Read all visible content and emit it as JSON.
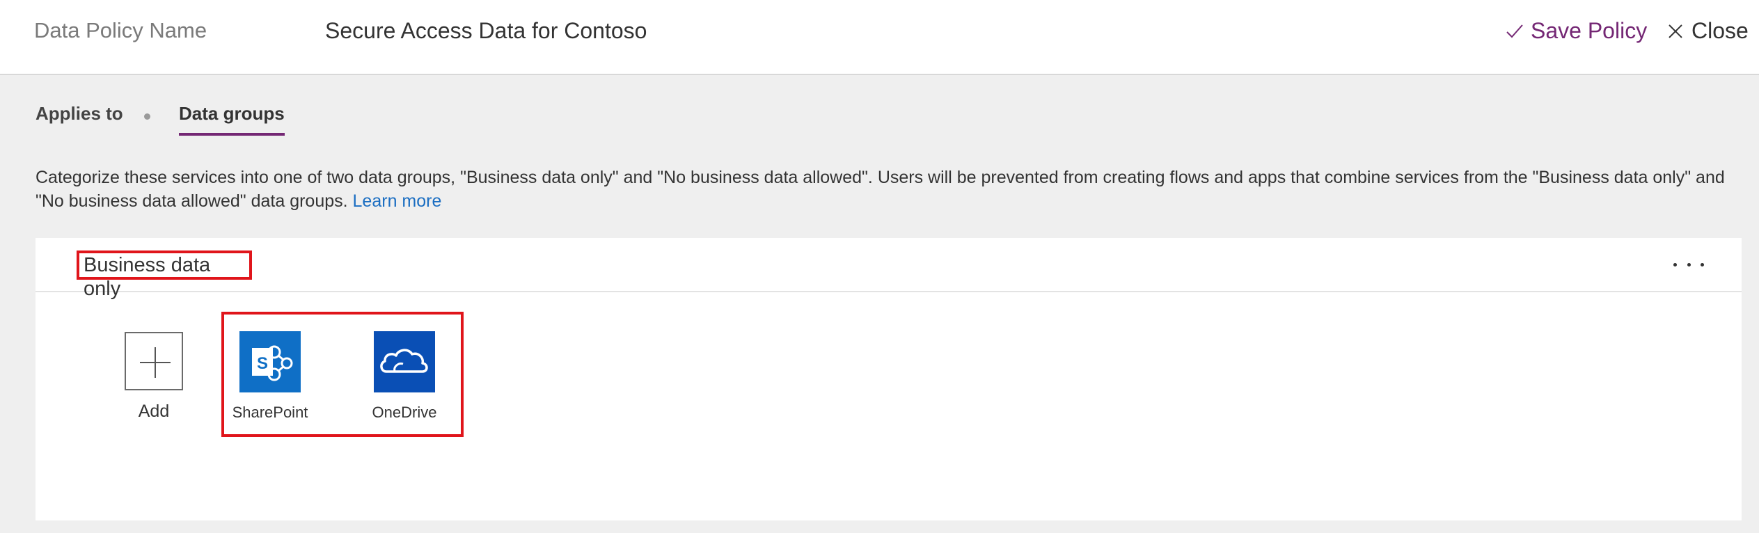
{
  "header": {
    "name_label": "Data Policy Name",
    "name_value": "Secure Access Data for Contoso",
    "save_label": "Save Policy",
    "close_label": "Close"
  },
  "tabs": [
    {
      "label": "Applies to",
      "active": false
    },
    {
      "label": "Data groups",
      "active": true
    }
  ],
  "description": {
    "text": "Categorize these services into one of two data groups, \"Business data only\" and \"No business data allowed\". Users will be prevented from creating flows and apps that combine services from the \"Business data only\" and \"No business data allowed\" data groups. ",
    "link": "Learn more"
  },
  "group": {
    "title": "Business data only",
    "more_icon": "ellipsis-icon",
    "add_label": "Add",
    "services": [
      {
        "label": "SharePoint",
        "icon": "sharepoint-icon",
        "color": "#0f6fc6"
      },
      {
        "label": "OneDrive",
        "icon": "onedrive-icon",
        "color": "#0a4fb5"
      }
    ]
  },
  "colors": {
    "accent": "#742774",
    "link": "#1b6ec2",
    "highlight": "#e0151b"
  }
}
